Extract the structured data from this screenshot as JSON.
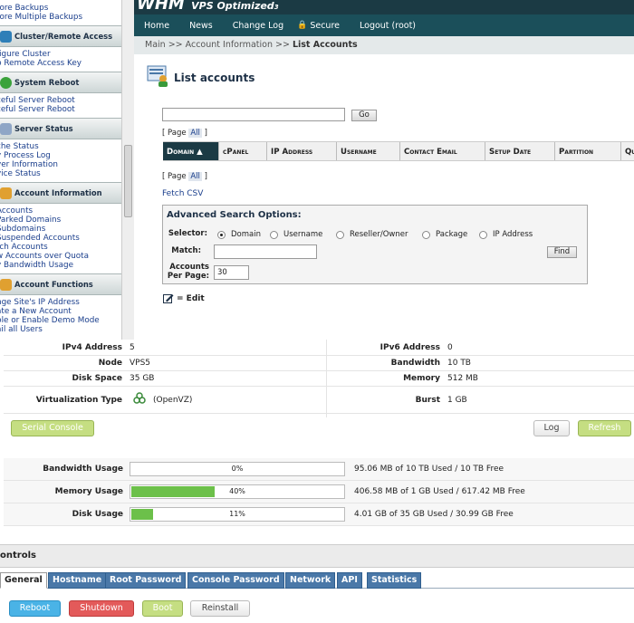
{
  "sidebar": {
    "top_links": [
      "tore Backups",
      "tore Multiple Backups"
    ],
    "sections": [
      {
        "title": "Cluster/Remote Access",
        "links": [
          "figure Cluster",
          "p Remote Access Key"
        ]
      },
      {
        "title": "System Reboot",
        "links": [
          "ceful Server Reboot",
          "ceful Server Reboot"
        ]
      },
      {
        "title": "Server Status",
        "links": [
          "che Status",
          "y Process Log",
          "ver Information",
          "vice Status"
        ]
      },
      {
        "title": "Account Information",
        "links": [
          "Accounts",
          "Parked Domains",
          "Subdomains",
          "Suspended Accounts",
          "rch Accounts",
          "w Accounts over Quota",
          "v Bandwidth Usage"
        ]
      },
      {
        "title": "Account Functions",
        "links": [
          "nge Site's IP Address",
          "ate a New Account",
          "ble or Enable Demo Mode",
          "ail all Users"
        ]
      }
    ]
  },
  "header": {
    "logo": "WHM",
    "logo_sub": "VPS Optimized",
    "logo_num": "3",
    "nav": [
      "Home",
      "News",
      "Change Log",
      "Secure",
      "Logout (root)"
    ]
  },
  "breadcrumb": {
    "path": "Main >> Account Information >> ",
    "current": "List Accounts"
  },
  "list": {
    "title": "List accounts",
    "go_label": "Go",
    "page_prefix": "[ Page",
    "page_all": "All",
    "page_suffix": "]",
    "columns": [
      "Domain ▲",
      "cPanel",
      "IP Address",
      "Username",
      "Contact Email",
      "Setup Date",
      "Partition",
      "Qu"
    ],
    "fetch_csv": "Fetch CSV",
    "edit_label": "= Edit"
  },
  "advanced": {
    "title": "Advanced Search Options:",
    "selector_label": "Selector:",
    "options": [
      "Domain",
      "Username",
      "Reseller/Owner",
      "Package",
      "IP Address"
    ],
    "selected": "Domain",
    "match_label": "Match:",
    "find_label": "Find",
    "per_page_label_1": "Accounts",
    "per_page_label_2": "Per Page:",
    "per_page_value": "30"
  },
  "vps_info": {
    "ipv4_label": "IPv4 Address",
    "ipv4_value": "5",
    "ipv6_label": "IPv6 Address",
    "ipv6_value": "0",
    "node_label": "Node",
    "node_value": "VPS5",
    "bandwidth_label": "Bandwidth",
    "bandwidth_value": "10 TB",
    "disk_label": "Disk Space",
    "disk_value": "35 GB",
    "memory_label": "Memory",
    "memory_value": "512 MB",
    "virt_label": "Virtualization Type",
    "virt_value": "(OpenVZ)",
    "burst_label": "Burst",
    "burst_value": "1 GB",
    "serial_console": "Serial Console",
    "log": "Log",
    "refresh": "Refresh"
  },
  "usage": [
    {
      "label": "Bandwidth Usage",
      "percent": 0,
      "percent_text": "0%",
      "detail": "95.06 MB of 10 TB Used / 10 TB Free"
    },
    {
      "label": "Memory Usage",
      "percent": 40,
      "percent_text": "40%",
      "detail": "406.58 MB of 1 GB Used / 617.42 MB Free"
    },
    {
      "label": "Disk Usage",
      "percent": 11,
      "percent_text": "11%",
      "detail": "4.01 GB of 35 GB Used / 30.99 GB Free"
    }
  ],
  "controls": {
    "title": "ontrols",
    "tabs": [
      "General",
      "Hostname",
      "Root Password",
      "Console Password",
      "Network",
      "API",
      "Statistics"
    ],
    "active_tab": "General",
    "buttons": {
      "reboot": "Reboot",
      "shutdown": "Shutdown",
      "boot": "Boot",
      "reinstall": "Reinstall"
    }
  },
  "colors": {
    "nav_bg": "#1b4f5a",
    "bar_fill": "#6cc04a",
    "tab_bg": "#4a78a8",
    "reboot": "#4ab3e6",
    "shutdown": "#e35a5a",
    "boot": "#b8d86a"
  }
}
